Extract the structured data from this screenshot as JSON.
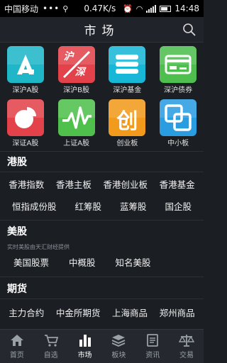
{
  "status_bar": {
    "carrier": "中国移动",
    "dots": "•••",
    "speed": "0.47K/s",
    "time": "14:48"
  },
  "header": {
    "title": "市场"
  },
  "tiles": [
    {
      "label": "深沪A股",
      "color": "#20b7c9",
      "icon": "letter-a-icon"
    },
    {
      "label": "深沪B股",
      "color": "#e4434c",
      "icon": "shanghai-shenzhen-logo-icon"
    },
    {
      "label": "深沪基金",
      "color": "#1ab8d8",
      "icon": "database-stack-icon"
    },
    {
      "label": "深沪债券",
      "color": "#4fbf4f",
      "icon": "card-icon"
    },
    {
      "label": "深证A股",
      "color": "#e4434c",
      "icon": "pie-chart-icon"
    },
    {
      "label": "上证A股",
      "color": "#50c04c",
      "icon": "line-wave-icon"
    },
    {
      "label": "创业板",
      "color": "#f39a1d",
      "icon": "chuang-char-icon"
    },
    {
      "label": "中小板",
      "color": "#2a9ee0",
      "icon": "overlap-squares-icon"
    }
  ],
  "tile_glyphs": {
    "hu": "沪",
    "shen": "深",
    "chuang": "创"
  },
  "sections": {
    "hk": {
      "title": "港股",
      "row1": [
        "香港指数",
        "香港主板",
        "香港创业板",
        "香港基金"
      ],
      "row2": [
        "恒指成份股",
        "红筹股",
        "蓝筹股",
        "国企股"
      ]
    },
    "us": {
      "title": "美股",
      "subtitle": "实时美股由天汇财经提供",
      "row1": [
        "美国股票",
        "中概股",
        "知名美股"
      ]
    },
    "futures": {
      "title": "期货",
      "row1": [
        "主力合约",
        "中金所期货",
        "上海商品",
        "郑州商品"
      ]
    }
  },
  "tabbar": [
    {
      "label": "首页",
      "icon": "home-icon",
      "active": false
    },
    {
      "label": "自选",
      "icon": "cart-icon",
      "active": false
    },
    {
      "label": "市场",
      "icon": "bar-chart-icon",
      "active": true
    },
    {
      "label": "板块",
      "icon": "layers-icon",
      "active": false
    },
    {
      "label": "资讯",
      "icon": "news-icon",
      "active": false
    },
    {
      "label": "交易",
      "icon": "scale-icon",
      "active": false
    }
  ]
}
